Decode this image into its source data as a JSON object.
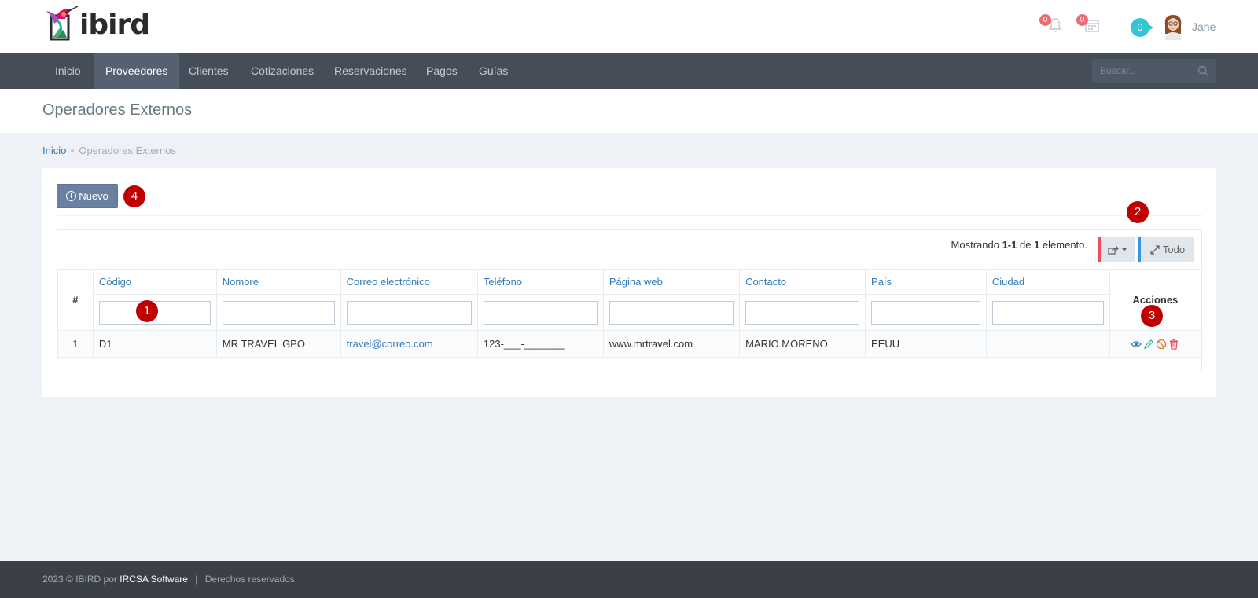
{
  "brand": {
    "name": "ibird"
  },
  "header": {
    "notifications_count": "0",
    "calendar_count": "0",
    "messages_count": "0",
    "username": "Jane"
  },
  "nav": {
    "items": [
      {
        "label": "Inicio"
      },
      {
        "label": "Proveedores"
      },
      {
        "label": "Clientes"
      },
      {
        "label": "Cotizaciones"
      },
      {
        "label": "Reservaciones"
      },
      {
        "label": "Pagos"
      },
      {
        "label": "Guías"
      }
    ],
    "active": "Proveedores",
    "search_placeholder": "Buscar..."
  },
  "page": {
    "title": "Operadores Externos",
    "breadcrumb": [
      "Inicio",
      "Operadores Externos"
    ]
  },
  "toolbar": {
    "new_label": "Nuevo",
    "todo_label": "Todo"
  },
  "summary": {
    "prefix": "Mostrando ",
    "range": "1-1",
    "middle": " de ",
    "total": "1",
    "suffix": " elemento."
  },
  "table": {
    "hash_header": "#",
    "columns": [
      "Código",
      "Nombre",
      "Correo electrónico",
      "Teléfono",
      "Página web",
      "Contacto",
      "País",
      "Ciudad"
    ],
    "actions_header": "Acciones",
    "rows": [
      {
        "num": "1",
        "codigo": "D1",
        "nombre": "MR TRAVEL GPO",
        "correo": "travel@correo.com",
        "telefono": "123-___-_______",
        "web": "www.mrtravel.com",
        "contacto": "MARIO MORENO",
        "pais": "EEUU",
        "ciudad": ""
      }
    ]
  },
  "markers": [
    "1",
    "2",
    "3",
    "4"
  ],
  "footer": {
    "prefix": "2023 © IBIRD por ",
    "company": "IRCSA Software",
    "separator": "|",
    "rights": "Derechos reservados."
  },
  "colors": {
    "navbar": "#444d58",
    "nav_active": "#55616f",
    "primary_button": "#6a80a0",
    "link": "#337ab7",
    "marker": "#c00000",
    "badge": "#ed6b75",
    "footer": "#3a3f48"
  }
}
